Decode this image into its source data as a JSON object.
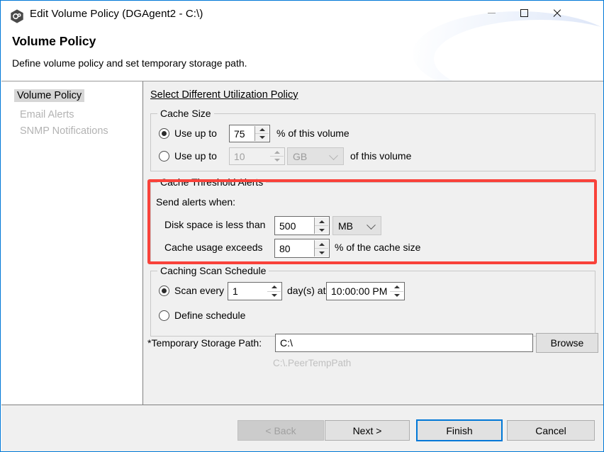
{
  "window": {
    "title": "Edit Volume Policy (DGAgent2 - C:\\)",
    "icon": "app-hex-icon",
    "controls": {
      "minimize": "minimize-icon",
      "maximize": "maximize-icon",
      "close": "close-icon"
    }
  },
  "header": {
    "title": "Volume Policy",
    "subtitle": "Define volume policy and set temporary storage path."
  },
  "sidebar": {
    "items": [
      {
        "label": "Volume Policy",
        "state": "selected"
      },
      {
        "label": "Email Alerts",
        "state": "disabled"
      },
      {
        "label": "SNMP Notifications",
        "state": "disabled"
      }
    ]
  },
  "main": {
    "utilization_link": "Select Different Utilization Policy",
    "cache_size": {
      "legend": "Cache Size",
      "option_percent": {
        "label": "Use up to",
        "value": "75",
        "suffix": "% of this volume",
        "selected": true
      },
      "option_absolute": {
        "label": "Use up to",
        "value": "10",
        "unit": "GB",
        "suffix": "of this volume",
        "selected": false
      }
    },
    "cache_threshold_alerts": {
      "legend": "Cache Threshold Alerts",
      "intro": "Send alerts when:",
      "disk_space": {
        "label": "Disk space is less than",
        "value": "500",
        "unit": "MB"
      },
      "cache_usage": {
        "label": "Cache usage exceeds",
        "value": "80",
        "suffix": "% of the cache size"
      },
      "highlight_color": "#f9423a"
    },
    "scan_schedule": {
      "legend": "Caching Scan Schedule",
      "scan_every": {
        "label": "Scan every",
        "value": "1",
        "middle": "day(s) at",
        "time": "10:00:00 PM",
        "selected": true
      },
      "define_schedule": {
        "label": "Define schedule",
        "selected": false
      }
    },
    "temp_path": {
      "label": "*Temporary Storage Path:",
      "value": "C:\\",
      "browse_label": "Browse",
      "hint": "C:\\.PeerTempPath"
    }
  },
  "footer": {
    "back": "< Back",
    "next": "Next >",
    "finish": "Finish",
    "cancel": "Cancel"
  }
}
